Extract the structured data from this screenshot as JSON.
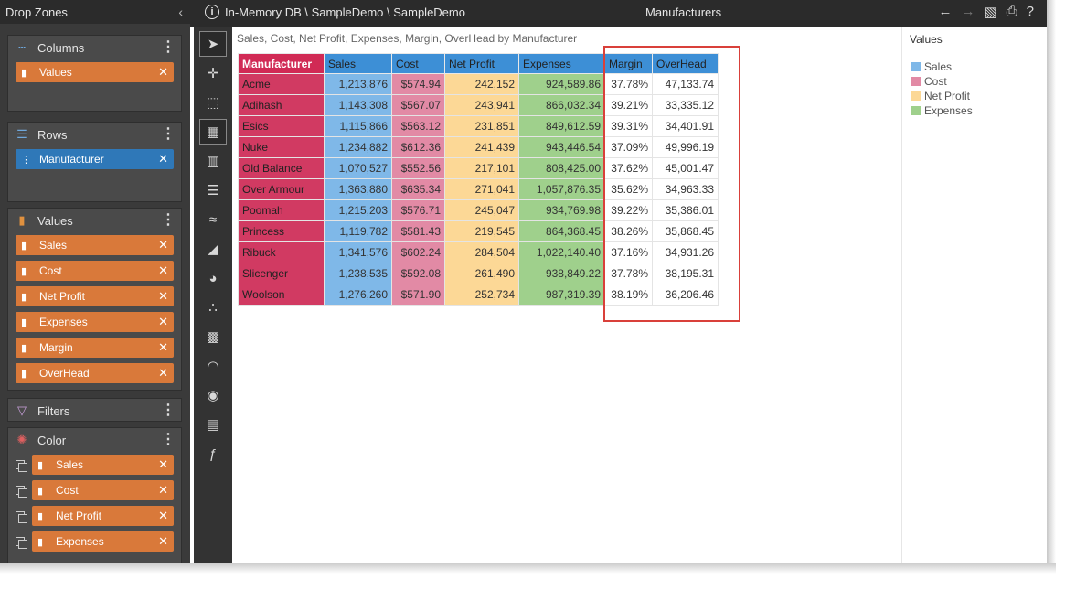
{
  "left_panel": {
    "title": "Drop Zones",
    "columns": {
      "label": "Columns",
      "items": [
        "Values"
      ]
    },
    "rows": {
      "label": "Rows",
      "items": [
        "Manufacturer"
      ]
    },
    "values": {
      "label": "Values",
      "items": [
        "Sales",
        "Cost",
        "Net Profit",
        "Expenses",
        "Margin",
        "OverHead"
      ]
    },
    "filters": {
      "label": "Filters"
    },
    "color": {
      "label": "Color",
      "items": [
        "Sales",
        "Cost",
        "Net Profit",
        "Expenses"
      ]
    }
  },
  "topbar": {
    "path": "In-Memory DB \\ SampleDemo \\ SampleDemo",
    "title": "Manufacturers",
    "help": "?"
  },
  "viz": {
    "title": "Sales, Cost, Net Profit, Expenses, Margin, OverHead by Manufacturer",
    "headers": [
      "Manufacturer",
      "Sales",
      "Cost",
      "Net Profit",
      "Expenses",
      "Margin",
      "OverHead"
    ],
    "rows": [
      [
        "Acme",
        "1,213,876",
        "$574.94",
        "242,152",
        "924,589.86",
        "37.78%",
        "47,133.74"
      ],
      [
        "Adihash",
        "1,143,308",
        "$567.07",
        "243,941",
        "866,032.34",
        "39.21%",
        "33,335.12"
      ],
      [
        "Esics",
        "1,115,866",
        "$563.12",
        "231,851",
        "849,612.59",
        "39.31%",
        "34,401.91"
      ],
      [
        "Nuke",
        "1,234,882",
        "$612.36",
        "241,439",
        "943,446.54",
        "37.09%",
        "49,996.19"
      ],
      [
        "Old Balance",
        "1,070,527",
        "$552.56",
        "217,101",
        "808,425.00",
        "37.62%",
        "45,001.47"
      ],
      [
        "Over Armour",
        "1,363,880",
        "$635.34",
        "271,041",
        "1,057,876.35",
        "35.62%",
        "34,963.33"
      ],
      [
        "Poomah",
        "1,215,203",
        "$576.71",
        "245,047",
        "934,769.98",
        "39.22%",
        "35,386.01"
      ],
      [
        "Princess",
        "1,119,782",
        "$581.43",
        "219,545",
        "864,368.45",
        "38.26%",
        "35,868.45"
      ],
      [
        "Ribuck",
        "1,341,576",
        "$602.24",
        "284,504",
        "1,022,140.40",
        "37.16%",
        "34,931.26"
      ],
      [
        "Slicenger",
        "1,238,535",
        "$592.08",
        "261,490",
        "938,849.22",
        "37.78%",
        "38,195.31"
      ],
      [
        "Woolson",
        "1,276,260",
        "$571.90",
        "252,734",
        "987,319.39",
        "38.19%",
        "36,206.46"
      ]
    ]
  },
  "legend": {
    "title": "Values",
    "items": [
      {
        "label": "Sales",
        "color": "#7fb8e8"
      },
      {
        "label": "Cost",
        "color": "#e28aa5"
      },
      {
        "label": "Net Profit",
        "color": "#fcd896"
      },
      {
        "label": "Expenses",
        "color": "#9fd08c"
      }
    ]
  },
  "colors": {
    "pill_orange": "#d9793a",
    "pill_blue": "#2f78b8",
    "manufacturer": "#d13a62",
    "highlight_box": "#d9403a"
  }
}
